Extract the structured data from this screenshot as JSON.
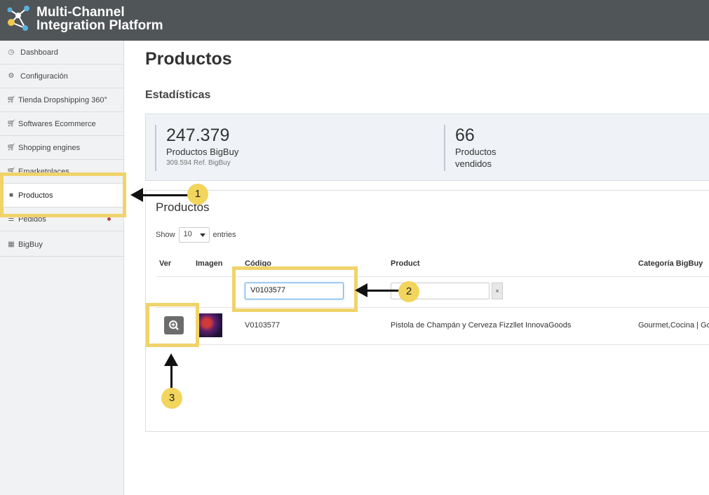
{
  "app": {
    "title_line1": "Multi-Channel",
    "title_line2": "Integration Platform"
  },
  "sidebar": {
    "items": [
      {
        "label": "Dashboard",
        "icon": "dashboard-icon"
      },
      {
        "label": "Configuración",
        "icon": "gear-icon"
      },
      {
        "label": "Tienda Dropshipping 360°",
        "icon": "cart-icon"
      },
      {
        "label": "Softwares Ecommerce",
        "icon": "cart-icon"
      },
      {
        "label": "Shopping engines",
        "icon": "cart-icon"
      },
      {
        "label": "Emarketplaces",
        "icon": "cart-icon"
      },
      {
        "label": "Productos",
        "icon": "bag-icon"
      },
      {
        "label": "Pedidos",
        "icon": "list-icon"
      },
      {
        "label": "BigBuy",
        "icon": "bigbuy-icon"
      }
    ]
  },
  "page": {
    "title": "Productos",
    "stats_title": "Estadísticas"
  },
  "stats": [
    {
      "value": "247.379",
      "label": "Productos BigBuy",
      "sub": "309.594 Ref. BigBuy"
    },
    {
      "value": "66",
      "label_line1": "Productos",
      "label_line2": "vendidos"
    }
  ],
  "table": {
    "title": "Productos",
    "show_label": "Show",
    "entries_value": "10",
    "entries_label": "entries",
    "headers": [
      "Ver",
      "Imagen",
      "Código",
      "Product",
      "Categoría BigBuy"
    ],
    "filter_codigo": "V0103577",
    "filter_product": "",
    "clear_label": "×",
    "rows": [
      {
        "codigo": "V0103577",
        "product": "Pistola de Champán y Cerveza Fizzllet InnovaGoods",
        "categoria": "Gourmet,Cocina | Gou"
      }
    ]
  },
  "annotations": {
    "badge1": "1",
    "badge2": "2",
    "badge3": "3"
  },
  "colors": {
    "topbar": "#505557",
    "highlight": "#f0d36b",
    "badge": "#f1d55c"
  }
}
